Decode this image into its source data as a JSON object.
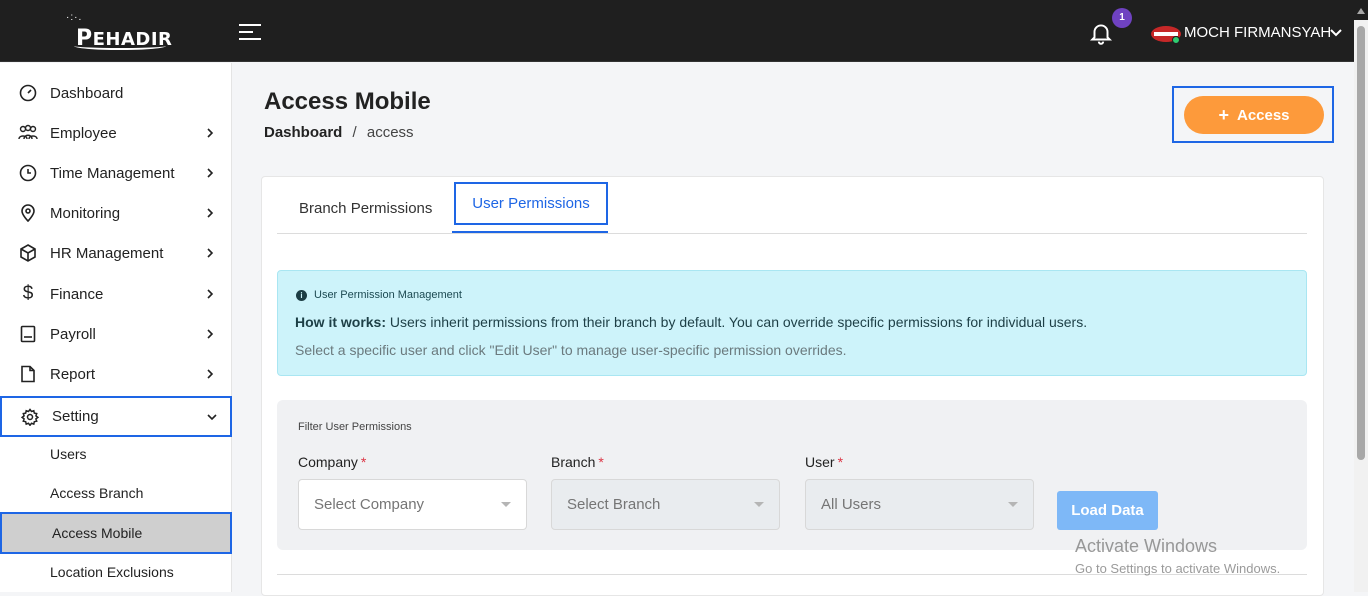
{
  "header": {
    "logo_text": "EHADIR",
    "notification_count": "1",
    "user_name": "MOCH FIRMANSYAH"
  },
  "sidebar": {
    "items": [
      {
        "label": "Dashboard",
        "icon": "gauge-icon"
      },
      {
        "label": "Employee",
        "icon": "people-icon"
      },
      {
        "label": "Time Management",
        "icon": "clock-icon"
      },
      {
        "label": "Monitoring",
        "icon": "location-pin-icon"
      },
      {
        "label": "HR Management",
        "icon": "box-icon"
      },
      {
        "label": "Finance",
        "icon": "dollar-icon"
      },
      {
        "label": "Payroll",
        "icon": "ledger-icon"
      },
      {
        "label": "Report",
        "icon": "file-icon"
      },
      {
        "label": "Setting",
        "icon": "gear-icon"
      }
    ],
    "sub_items": [
      {
        "label": "Users"
      },
      {
        "label": "Access Branch"
      },
      {
        "label": "Access Mobile"
      },
      {
        "label": "Location Exclusions"
      }
    ]
  },
  "page": {
    "title": "Access Mobile",
    "breadcrumb_root": "Dashboard",
    "breadcrumb_sep": "/",
    "breadcrumb_current": "access",
    "access_button": "Access"
  },
  "tabs": [
    {
      "label": "Branch Permissions"
    },
    {
      "label": "User Permissions"
    }
  ],
  "info": {
    "title": "User Permission Management",
    "lead": "How it works:",
    "line1": " Users inherit permissions from their branch by default. You can override specific permissions for individual users.",
    "line2": "Select a specific user and click \"Edit User\" to manage user-specific permission overrides."
  },
  "filter": {
    "title": "Filter User Permissions",
    "company_label": "Company",
    "company_placeholder": "Select Company",
    "branch_label": "Branch",
    "branch_placeholder": "Select Branch",
    "user_label": "User",
    "user_placeholder": "All Users",
    "required_mark": "*",
    "load_button": "Load Data"
  },
  "watermark": {
    "line1": "Activate Windows",
    "line2": "Go to Settings to activate Windows."
  },
  "colors": {
    "accent": "#1e66e5",
    "orange": "#fd9a3b",
    "info_bg": "#cdf3fa"
  }
}
